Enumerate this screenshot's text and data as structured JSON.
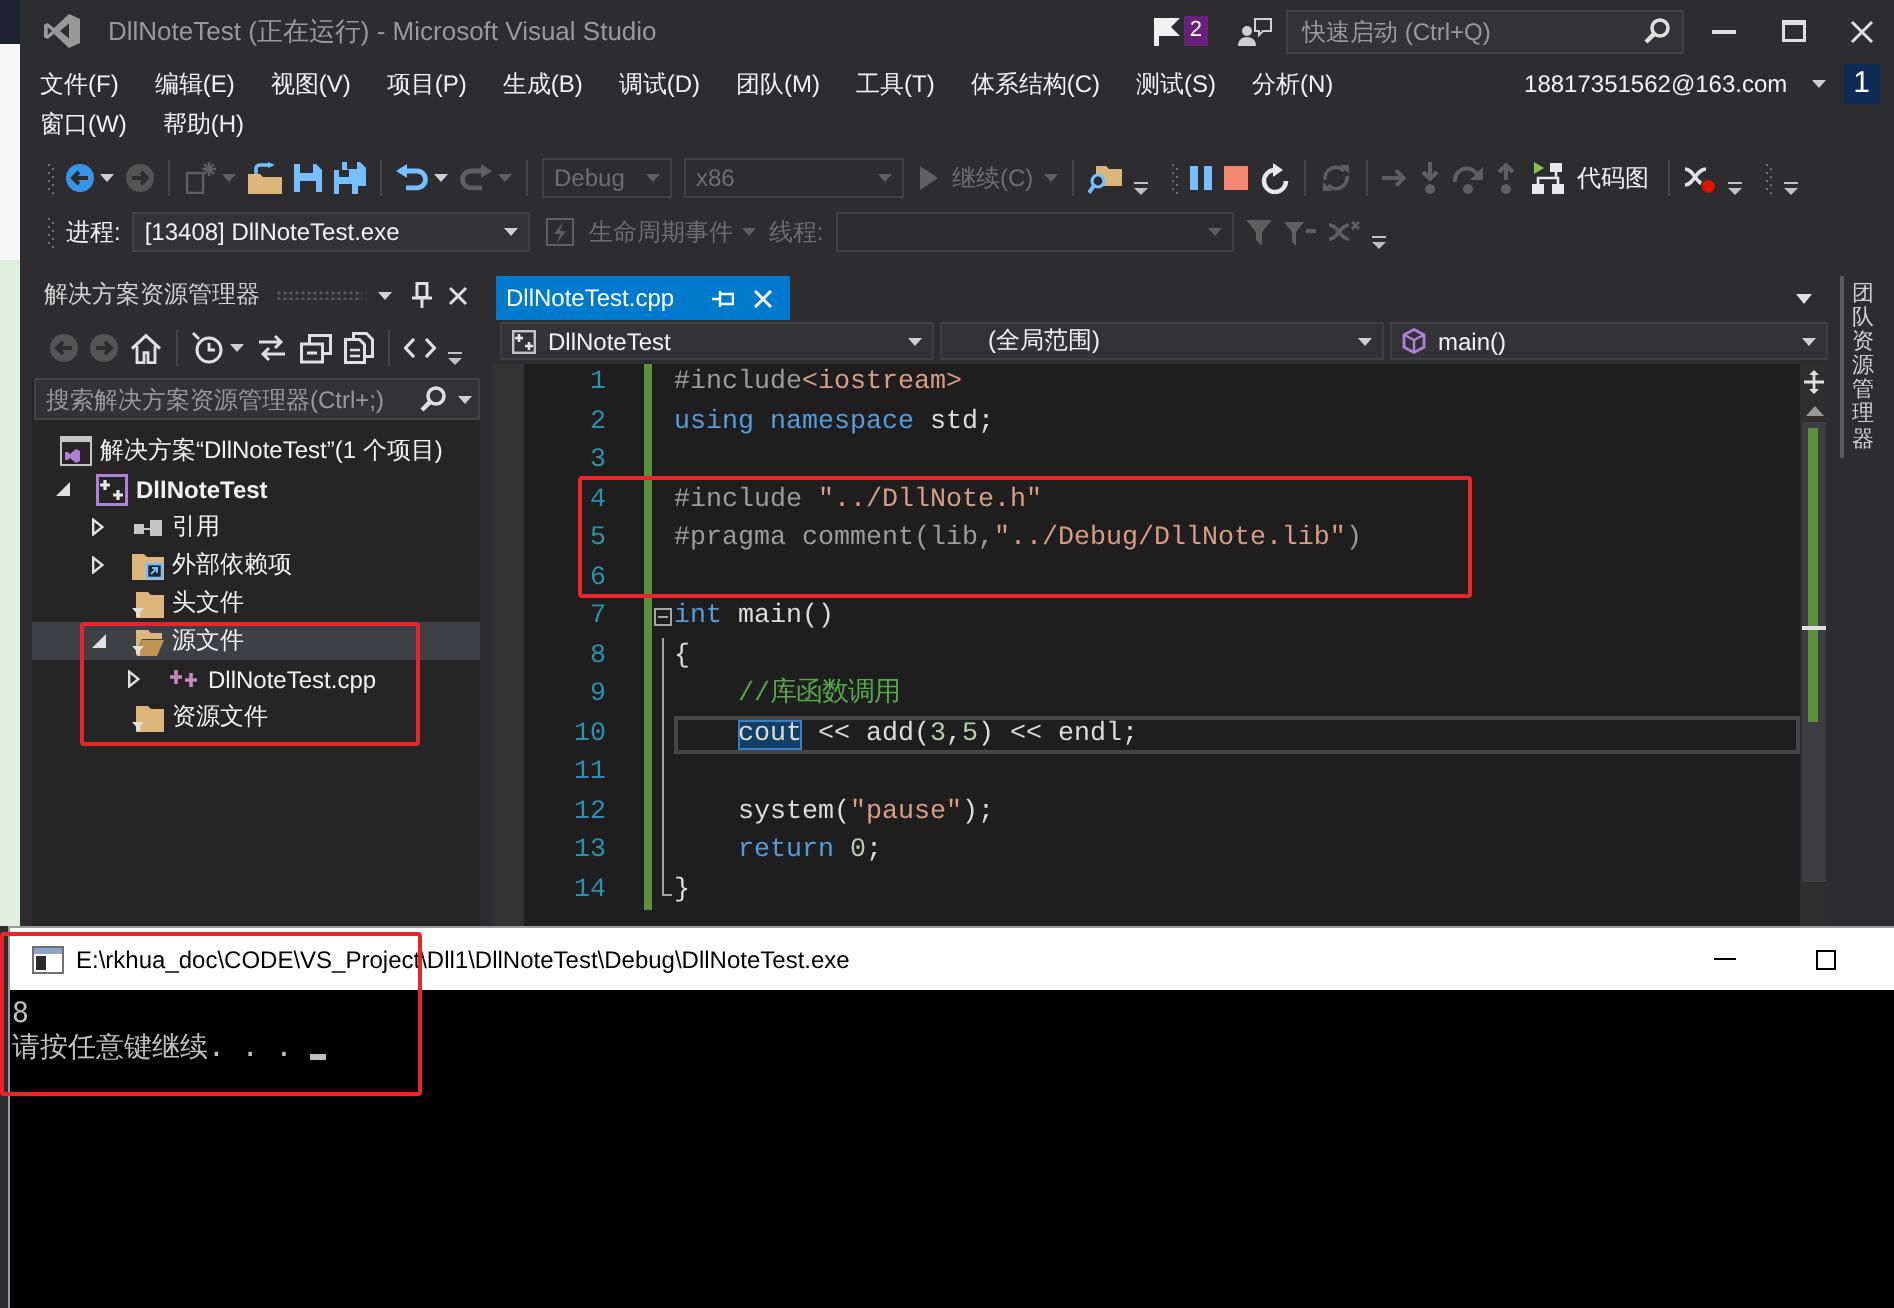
{
  "window": {
    "title": "DllNoteTest (正在运行) - Microsoft Visual Studio",
    "notifications": "2",
    "quick_launch": {
      "placeholder": "快速启动 (Ctrl+Q)"
    }
  },
  "menu": {
    "rows": [
      [
        "文件(F)",
        "编辑(E)",
        "视图(V)",
        "项目(P)",
        "生成(B)",
        "调试(D)",
        "团队(M)",
        "工具(T)",
        "体系结构(C)",
        "测试(S)",
        "分析(N)"
      ],
      [
        "窗口(W)",
        "帮助(H)"
      ]
    ]
  },
  "account": {
    "name": "18817351562@163.com",
    "badge": "1"
  },
  "toolbars": [
    [
      {
        "groups": [
          [
            {
              "kind": "back",
              "disabled": false
            },
            {
              "kind": "caret",
              "disabled": false
            },
            {
              "kind": "forward",
              "disabled": true
            }
          ],
          [
            {
              "kind": "new_project",
              "disabled": true
            },
            {
              "kind": "caret",
              "disabled": true
            },
            {
              "kind": "open",
              "disabled": false
            },
            {
              "kind": "save",
              "disabled": false
            },
            {
              "kind": "save_all",
              "disabled": false
            }
          ],
          [
            {
              "kind": "undo",
              "disabled": false
            },
            {
              "kind": "caret",
              "disabled": false
            },
            {
              "kind": "redo",
              "disabled": true
            },
            {
              "kind": "caret",
              "disabled": true
            }
          ],
          [
            {
              "kind": "configuration_combo",
              "value": "Debug",
              "disabled": true
            },
            {
              "kind": "platform_combo",
              "value": "x86",
              "disabled": true
            },
            {
              "kind": "continue",
              "label": "继续(C)",
              "disabled": true
            },
            {
              "kind": "caret",
              "disabled": true
            }
          ],
          [
            {
              "kind": "find",
              "disabled": false
            }
          ]
        ],
        "overflow": true
      },
      {
        "groups": [
          [
            {
              "kind": "pause",
              "disabled": false
            },
            {
              "kind": "stop",
              "disabled": false
            },
            {
              "kind": "restart",
              "disabled": false
            }
          ],
          [
            {
              "kind": "refresh",
              "disabled": true
            }
          ],
          [
            {
              "kind": "next_statement",
              "disabled": true
            },
            {
              "kind": "step_into",
              "disabled": true
            },
            {
              "kind": "step_over",
              "disabled": true
            },
            {
              "kind": "step_out",
              "disabled": true
            },
            {
              "kind": "code_map",
              "label": "代码图",
              "disabled": false
            }
          ],
          [
            {
              "kind": "breakpoints",
              "disabled": false
            }
          ]
        ],
        "overflow": true
      },
      {
        "overflow": true
      }
    ],
    [
      {
        "groups": [
          [
            {
              "kind": "label",
              "label": "进程:",
              "disabled": false
            },
            {
              "kind": "process_combo",
              "value": "[13408] DllNoteTest.exe",
              "disabled": false
            },
            {
              "kind": "lifecycle",
              "label": "生命周期事件",
              "disabled": true
            },
            {
              "kind": "caret",
              "disabled": true
            },
            {
              "kind": "label",
              "label": "线程:",
              "disabled": true
            },
            {
              "kind": "thread_combo",
              "disabled": true
            },
            {
              "kind": "filter",
              "disabled": true
            },
            {
              "kind": "filter_clear",
              "disabled": true
            },
            {
              "kind": "flag_cross",
              "disabled": true
            }
          ]
        ],
        "overflow": true
      }
    ]
  ],
  "solution_explorer": {
    "title": "解决方案资源管理器",
    "toolbar": {
      "groups": [
        [
          {
            "kind": "back",
            "disabled": true
          },
          {
            "kind": "forward",
            "disabled": true
          },
          {
            "kind": "home",
            "disabled": false
          }
        ],
        [
          {
            "kind": "history",
            "disabled": false
          },
          {
            "kind": "caret",
            "disabled": false
          },
          {
            "kind": "sync",
            "disabled": false
          },
          {
            "kind": "collapse",
            "disabled": false
          },
          {
            "kind": "show_all",
            "disabled": false
          }
        ],
        [
          {
            "kind": "code",
            "disabled": false
          }
        ]
      ],
      "overflow": true
    },
    "search": {
      "placeholder": "搜索解决方案资源管理器(Ctrl+;)"
    },
    "tree": [
      {
        "label": "解决方案“DllNoteTest”(1 个项目)",
        "kind": "solution",
        "selected": false,
        "children": [
          {
            "label": "DllNoteTest",
            "kind": "project",
            "expanded": true,
            "selected": false,
            "children": [
              {
                "label": "引用",
                "kind": "references",
                "expanded": false,
                "selected": false
              },
              {
                "label": "外部依赖项",
                "kind": "external",
                "expanded": false,
                "selected": false
              },
              {
                "label": "头文件",
                "kind": "filter",
                "selected": false
              },
              {
                "label": "源文件",
                "kind": "filter",
                "expanded": true,
                "selected": true,
                "children": [
                  {
                    "label": "DllNoteTest.cpp",
                    "kind": "cpp",
                    "expanded": false,
                    "selected": false
                  }
                ]
              },
              {
                "label": "资源文件",
                "kind": "filter",
                "selected": false
              }
            ]
          }
        ]
      }
    ]
  },
  "editor": {
    "tabs": [
      {
        "label": "DllNoteTest.cpp",
        "selected": true
      }
    ],
    "navigation": [
      {
        "kind": "project",
        "value": "DllNoteTest"
      },
      {
        "kind": "scope",
        "value": "(全局范围)"
      },
      {
        "kind": "member",
        "value": "main()"
      }
    ],
    "lines": [
      {
        "number": "1",
        "changed": true,
        "current": false,
        "tokens": [
          {
            "text": "#include",
            "kind": "preprocessor"
          },
          {
            "text": "<iostream>",
            "kind": "string"
          }
        ]
      },
      {
        "number": "2",
        "changed": true,
        "current": false,
        "tokens": [
          {
            "text": "using",
            "kind": "keyword"
          },
          {
            "text": " namespace",
            "kind": "keyword"
          },
          {
            "text": " std;",
            "kind": "plain"
          }
        ]
      },
      {
        "number": "3",
        "changed": true,
        "current": false
      },
      {
        "number": "4",
        "changed": true,
        "current": false,
        "tokens": [
          {
            "text": "#include ",
            "kind": "preprocessor"
          },
          {
            "text": "\"../DllNote.h\"",
            "kind": "string"
          }
        ]
      },
      {
        "number": "5",
        "changed": true,
        "current": false,
        "tokens": [
          {
            "text": "#pragma comment(lib,",
            "kind": "preprocessor"
          },
          {
            "text": "\"../Debug/DllNote.lib\"",
            "kind": "string"
          },
          {
            "text": ")",
            "kind": "preprocessor"
          }
        ]
      },
      {
        "number": "6",
        "changed": true,
        "current": false
      },
      {
        "number": "7",
        "changed": true,
        "current": false,
        "outline": {
          "kind": "start"
        },
        "tokens": [
          {
            "text": "int",
            "kind": "keyword"
          },
          {
            "text": " main()",
            "kind": "plain"
          }
        ]
      },
      {
        "number": "8",
        "changed": true,
        "current": false,
        "outline": {
          "kind": "body"
        },
        "tokens": [
          {
            "text": "{",
            "kind": "plain"
          }
        ]
      },
      {
        "number": "9",
        "changed": true,
        "current": false,
        "outline": {
          "kind": "body"
        },
        "tokens": [
          {
            "text": "    //库函数调用",
            "kind": "comment"
          }
        ]
      },
      {
        "number": "10",
        "changed": true,
        "current": true,
        "outline": {
          "kind": "body"
        },
        "tokens": [
          {
            "text": "    cout",
            "kind": "reference"
          },
          {
            "text": " << add(",
            "kind": "plain"
          },
          {
            "text": "3",
            "kind": "number"
          },
          {
            "text": ",",
            "kind": "plain"
          },
          {
            "text": "5",
            "kind": "number"
          },
          {
            "text": ") << endl;",
            "kind": "plain"
          }
        ]
      },
      {
        "number": "11",
        "changed": true,
        "current": false,
        "outline": {
          "kind": "body"
        }
      },
      {
        "number": "12",
        "changed": true,
        "current": false,
        "outline": {
          "kind": "body"
        },
        "tokens": [
          {
            "text": "    system(",
            "kind": "plain"
          },
          {
            "text": "\"pause\"",
            "kind": "string"
          },
          {
            "text": ");",
            "kind": "plain"
          }
        ]
      },
      {
        "number": "13",
        "changed": true,
        "current": false,
        "outline": {
          "kind": "body"
        },
        "tokens": [
          {
            "text": "    return",
            "kind": "keyword"
          },
          {
            "text": " 0",
            "kind": "number"
          },
          {
            "text": ";",
            "kind": "plain"
          }
        ]
      },
      {
        "number": "14",
        "changed": true,
        "current": false,
        "outline": {
          "kind": "end"
        },
        "tokens": [
          {
            "text": "}",
            "kind": "plain"
          }
        ]
      }
    ]
  },
  "side_tabs": [
    {
      "label": "团队资源管理器"
    }
  ],
  "console": {
    "title": "E:\\rkhua_doc\\CODE\\VS_Project\\Dll1\\DllNoteTest\\Debug\\DllNoteTest.exe",
    "output": [
      "8",
      "请按任意键继续. . ."
    ],
    "cursor": true
  },
  "annotations": [
    {
      "kind": "rectangle"
    },
    {
      "kind": "rectangle"
    },
    {
      "kind": "rectangle"
    }
  ]
}
